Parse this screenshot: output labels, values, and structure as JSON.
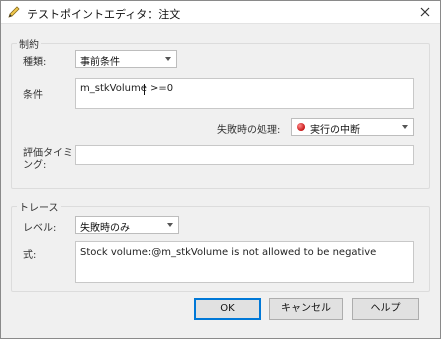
{
  "window": {
    "title": "テストポイントエディタ：注文"
  },
  "constraints": {
    "group_label": "制約",
    "type_label": "種類:",
    "type_value": "事前条件",
    "condition_label": "条件",
    "condition_value": "m_stkVolume >=0",
    "on_failure_label": "失敗時の処理:",
    "on_failure_value": "実行の中断",
    "timing_label_line1": "評価タイミ",
    "timing_label_line2": "ング:",
    "timing_value": ""
  },
  "trace": {
    "group_label": "トレース",
    "level_label": "レベル:",
    "level_value": "失敗時のみ",
    "expression_label": "式:",
    "expression_value": "Stock volume:@m_stkVolume is not allowed to be negative"
  },
  "buttons": {
    "ok": "OK",
    "cancel": "キャンセル",
    "help": "ヘルプ"
  },
  "colors": {
    "accent": "#0078d7",
    "stop_icon": "#c61515"
  }
}
